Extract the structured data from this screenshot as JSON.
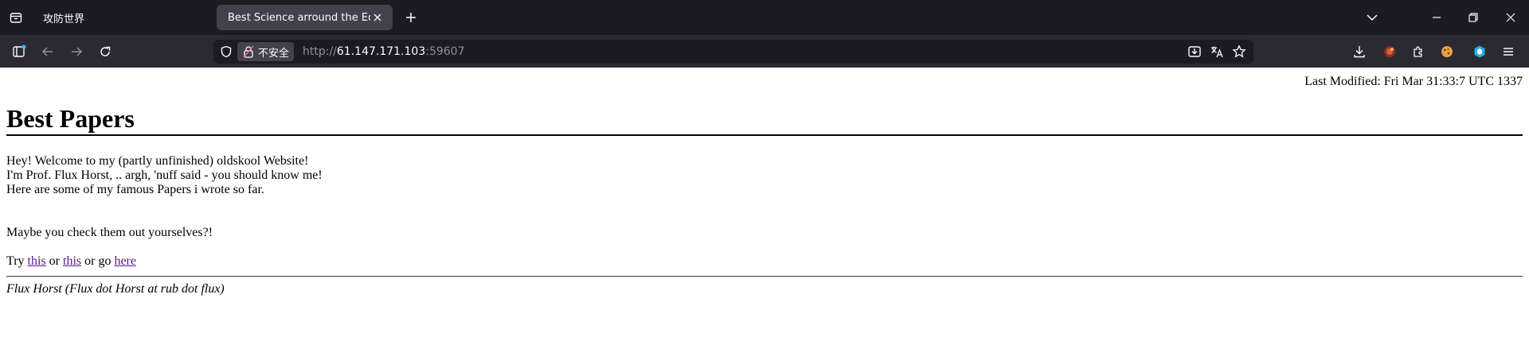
{
  "browser": {
    "tabs": [
      {
        "title": "攻防世界",
        "active": false
      },
      {
        "title": "Best Science arround the Edge",
        "active": true
      }
    ],
    "security_badge": "不安全",
    "url": {
      "scheme": "http://",
      "host": "61.147.171.103",
      "port": ":59607"
    },
    "colors": {
      "tabstrip": "#1c1b22",
      "toolbar": "#2b2a33",
      "active_tab": "#42414d",
      "text": "#fbfbfe"
    }
  },
  "page": {
    "last_modified": "Last Modified: Fri Mar 31:33:7 UTC 1337",
    "heading": "Best Papers",
    "intro_lines": [
      "Hey! Welcome to my (partly unfinished) oldskool Website!",
      "I'm Prof. Flux Horst, .. argh, 'nuff said - you should know me!",
      "Here are some of my famous Papers i wrote so far."
    ],
    "maybe": "Maybe you check them out yourselves?!",
    "try": {
      "prefix": "Try ",
      "link1": "this",
      "mid1": " or ",
      "link2": "this",
      "mid2": " or go ",
      "link3": "here"
    },
    "signature": "Flux Horst (Flux dot Horst at rub dot flux)",
    "link_color": "#551a8b"
  }
}
